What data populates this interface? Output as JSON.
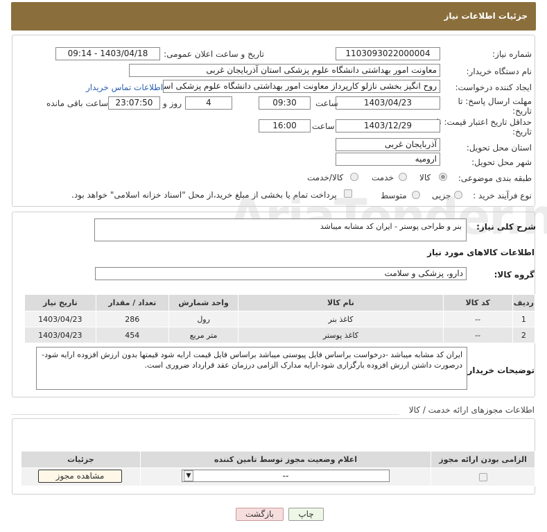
{
  "page": {
    "title": "جزئیات اطلاعات نیاز"
  },
  "info": {
    "need_number_label": "شماره نیاز:",
    "need_number": "1103093022000004",
    "announce_label": "تاریخ و ساعت اعلان عمومی:",
    "announce_value": "1403/04/18 - 09:14",
    "buyer_label": "نام دستگاه خریدار:",
    "buyer_value": "معاونت امور بهداشتی دانشگاه علوم پزشکی استان آذربایجان غربی",
    "creator_label": "ایجاد کننده درخواست:",
    "creator_value": "روح انگیز بخشی نازلو کارپرداز معاونت امور بهداشتی دانشگاه علوم پزشکی استا",
    "contact_link": "اطلاعات تماس خریدار",
    "deadline_label_1": "مهلت ارسال پاسخ: تا",
    "deadline_label_2": "تاریخ:",
    "deadline_date": "1403/04/23",
    "time_label": "ساعت",
    "deadline_time": "09:30",
    "days_value": "4",
    "days_label": "روز و",
    "remaining_time": "23:07:50",
    "remaining_label": "ساعت باقی مانده",
    "validity_label_1": "حداقل تاریخ اعتبار قیمت: تا",
    "validity_label_2": "تاریخ:",
    "validity_date": "1403/12/29",
    "validity_time": "16:00",
    "province_label": "استان محل تحویل:",
    "province_value": "آذربایجان غربی",
    "city_label": "شهر محل تحویل:",
    "city_value": "ارومیه",
    "category_label": "طبقه بندی موضوعی:",
    "category_options": [
      "کالا",
      "خدمت",
      "کالا/خدمت"
    ],
    "process_label": "نوع فرآیند خرید :",
    "process_options": [
      "جزیی",
      "متوسط"
    ],
    "payment_note": "پرداخت تمام یا بخشی از مبلغ خرید،از محل \"اسناد خزانه اسلامی\" خواهد بود."
  },
  "summary": {
    "label": "شرح کلی نیاز:",
    "value": "بنر و طراحی پوستر - ایران کد مشابه میباشد",
    "goods_title": "اطلاعات کالاهای مورد نیاز",
    "group_label": "گروه کالا:",
    "group_value": "دارو، پزشکی و سلامت"
  },
  "goods_table": {
    "headers": [
      "ردیف",
      "کد کالا",
      "نام کالا",
      "واحد شمارش",
      "تعداد / مقدار",
      "تاریخ نیاز"
    ],
    "rows": [
      [
        "1",
        "--",
        "کاغذ بنر",
        "رول",
        "286",
        "1403/04/23"
      ],
      [
        "2",
        "--",
        "کاغذ پوستر",
        "متر مربع",
        "454",
        "1403/04/23"
      ]
    ]
  },
  "buyer_notes": {
    "label": "توضیحات خریدار:",
    "value": "ایران کد مشابه میباشد -درخواست براساس فایل پیوستی میباشد براساس فایل قیمت ارایه شود قیمتها بدون ارزش افزوده ارایه شود- درصورت داشتن ارزش افزوده بارگزاری شود-ارایه مدارک الزامی درزمان عقد قرارداد ضروری است."
  },
  "permits": {
    "title": "اطلاعات مجوزهای ارائه خدمت / کالا",
    "headers": [
      "الزامی بودن ارائه مجوز",
      "اعلام وضعیت مجوز توسط تامین کننده",
      "جزئیات"
    ],
    "select_value": "--",
    "view_button": "مشاهده مجوز"
  },
  "actions": {
    "print": "چاپ",
    "back": "بازگشت"
  },
  "watermark": "AriaTender.neT",
  "colors": {
    "header": "#8a6e3c",
    "link": "#2a5fb0",
    "back_bg": "#f7dede",
    "print_bg": "#eef7e6"
  }
}
